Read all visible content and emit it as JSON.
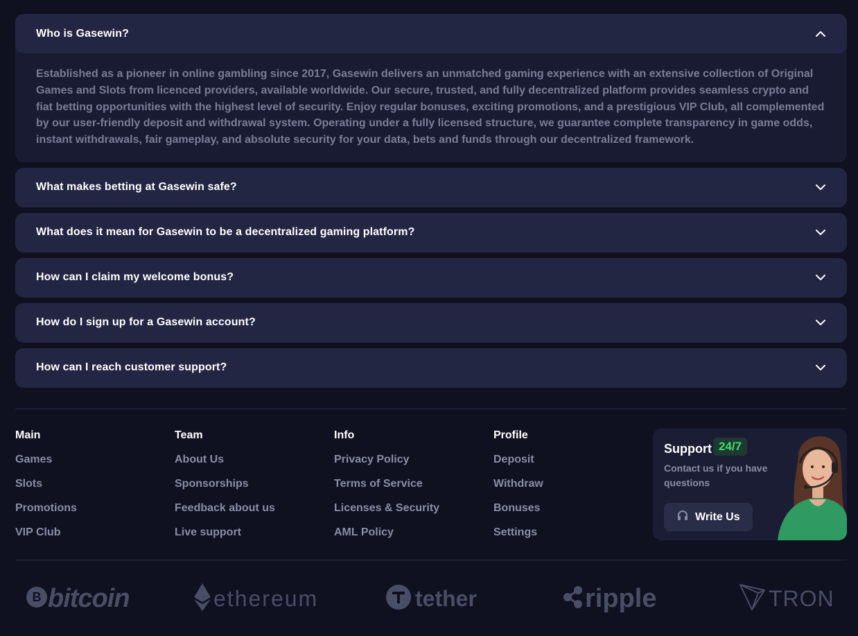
{
  "faq": {
    "items": [
      {
        "question": "Who is Gasewin?",
        "open": true,
        "answer": "Established as a pioneer in online gambling since 2017, Gasewin delivers an unmatched gaming experience with an extensive collection of Original Games and Slots from licenced providers, available worldwide. Our secure, trusted, and fully decentralized platform provides seamless crypto and fiat betting opportunities with the highest level of security. Enjoy regular bonuses, exciting promotions, and a prestigious VIP Club, all complemented by our user-friendly deposit and withdrawal system. Operating under a fully licensed structure, we guarantee complete transparency in game odds, instant withdrawals, fair gameplay, and absolute security for your data, bets and funds through our decentralized framework."
      },
      {
        "question": "What makes betting at Gasewin safe?",
        "open": false
      },
      {
        "question": "What does it mean for Gasewin to be a decentralized gaming platform?",
        "open": false
      },
      {
        "question": "How can I claim my welcome bonus?",
        "open": false
      },
      {
        "question": "How do I sign up for a Gasewin account?",
        "open": false
      },
      {
        "question": "How can I reach customer support?",
        "open": false
      }
    ]
  },
  "footer": {
    "columns": [
      {
        "title": "Main",
        "links": [
          "Games",
          "Slots",
          "Promotions",
          "VIP Club"
        ]
      },
      {
        "title": "Team",
        "links": [
          "About Us",
          "Sponsorships",
          "Feedback about us",
          "Live support"
        ]
      },
      {
        "title": "Info",
        "links": [
          "Privacy Policy",
          "Terms of Service",
          "Licenses & Security",
          "AML Policy"
        ]
      },
      {
        "title": "Profile",
        "links": [
          "Deposit",
          "Withdraw",
          "Bonuses",
          "Settings"
        ]
      }
    ],
    "support": {
      "title": "Support",
      "badge": "24/7",
      "text": "Contact us if you have questions",
      "button_label": "Write Us",
      "button_icon": "headset-icon"
    }
  },
  "payment_logos": [
    {
      "name": "bitcoin",
      "icon": "bitcoin-icon"
    },
    {
      "name": "ethereum",
      "icon": "ethereum-icon"
    },
    {
      "name": "tether",
      "icon": "tether-icon"
    },
    {
      "name": "ripple",
      "icon": "ripple-icon"
    },
    {
      "name": "TRON",
      "icon": "tron-icon"
    }
  ],
  "colors": {
    "background": "#0f1120",
    "card": "#232642",
    "accent_green": "#3ee06b",
    "muted_text": "#7a7d96"
  }
}
